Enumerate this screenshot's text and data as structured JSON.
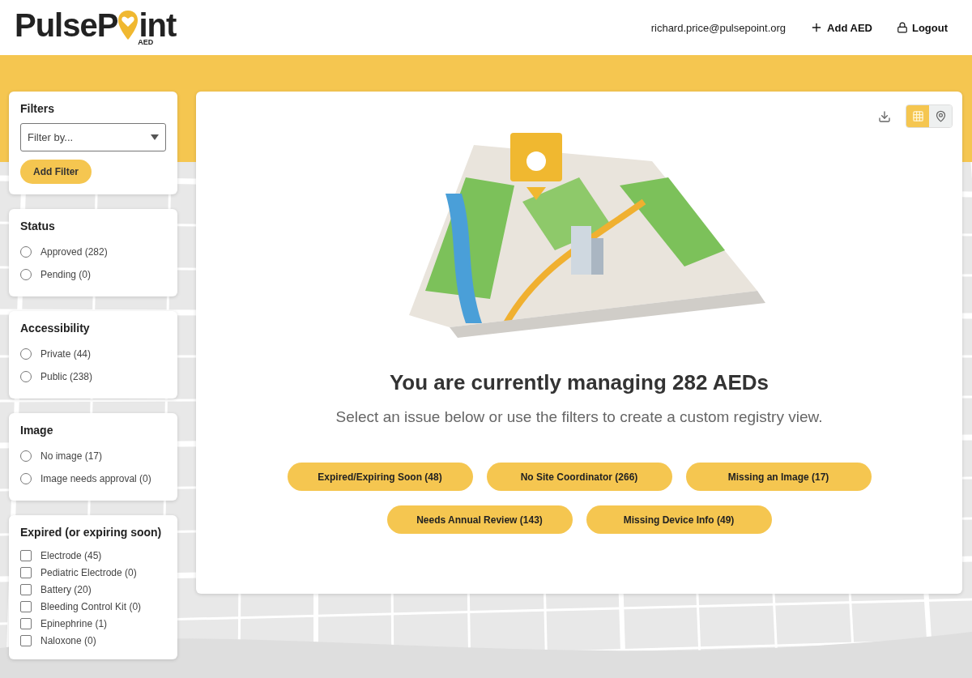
{
  "logo": {
    "name_start": "PulseP",
    "name_end": "int",
    "sub": "AED"
  },
  "header": {
    "user": "richard.price@pulsepoint.org",
    "actions": [
      {
        "kind": "add",
        "label": "Add AED"
      },
      {
        "kind": "logout",
        "label": "Logout"
      }
    ]
  },
  "filters": {
    "title": "Filters",
    "select": {
      "placeholder": "Filter by..."
    },
    "button": "Add Filter"
  },
  "groups": [
    {
      "title": "Status",
      "kind": "radio",
      "items": [
        {
          "label": "Approved (282)",
          "selected": false
        },
        {
          "label": "Pending (0)",
          "selected": false
        }
      ]
    },
    {
      "title": "Accessibility",
      "kind": "radio",
      "items": [
        {
          "label": "Private (44)",
          "selected": false
        },
        {
          "label": "Public (238)",
          "selected": false
        }
      ]
    },
    {
      "title": "Image",
      "kind": "radio",
      "items": [
        {
          "label": "No image (17)",
          "selected": false
        },
        {
          "label": "Image needs approval (0)",
          "selected": false
        }
      ]
    },
    {
      "title": "Expired (or expiring soon)",
      "kind": "checkbox",
      "items": [
        {
          "label": "Electrode (45)",
          "checked": false
        },
        {
          "label": "Pediatric Electrode (0)",
          "checked": false
        },
        {
          "label": "Battery (20)",
          "checked": false
        },
        {
          "label": "Bleeding Control Kit (0)",
          "checked": false
        },
        {
          "label": "Epinephrine (1)",
          "checked": false
        },
        {
          "label": "Naloxone (0)",
          "checked": false
        }
      ]
    }
  ],
  "views": [
    {
      "kind": "table",
      "selected": true
    },
    {
      "kind": "map",
      "selected": false
    }
  ],
  "main": {
    "illustration": {
      "kind": "picture"
    },
    "heading": "You are currently managing 282 AEDs",
    "subheading": "Select an issue below or use the filters to create a custom registry view.",
    "issue_rows": [
      [
        "Expired/Expiring Soon (48)",
        "No Site Coordinator (266)",
        "Missing an Image (17)"
      ],
      [
        "Needs Annual Review (143)",
        "Missing Device Info (49)"
      ]
    ]
  }
}
